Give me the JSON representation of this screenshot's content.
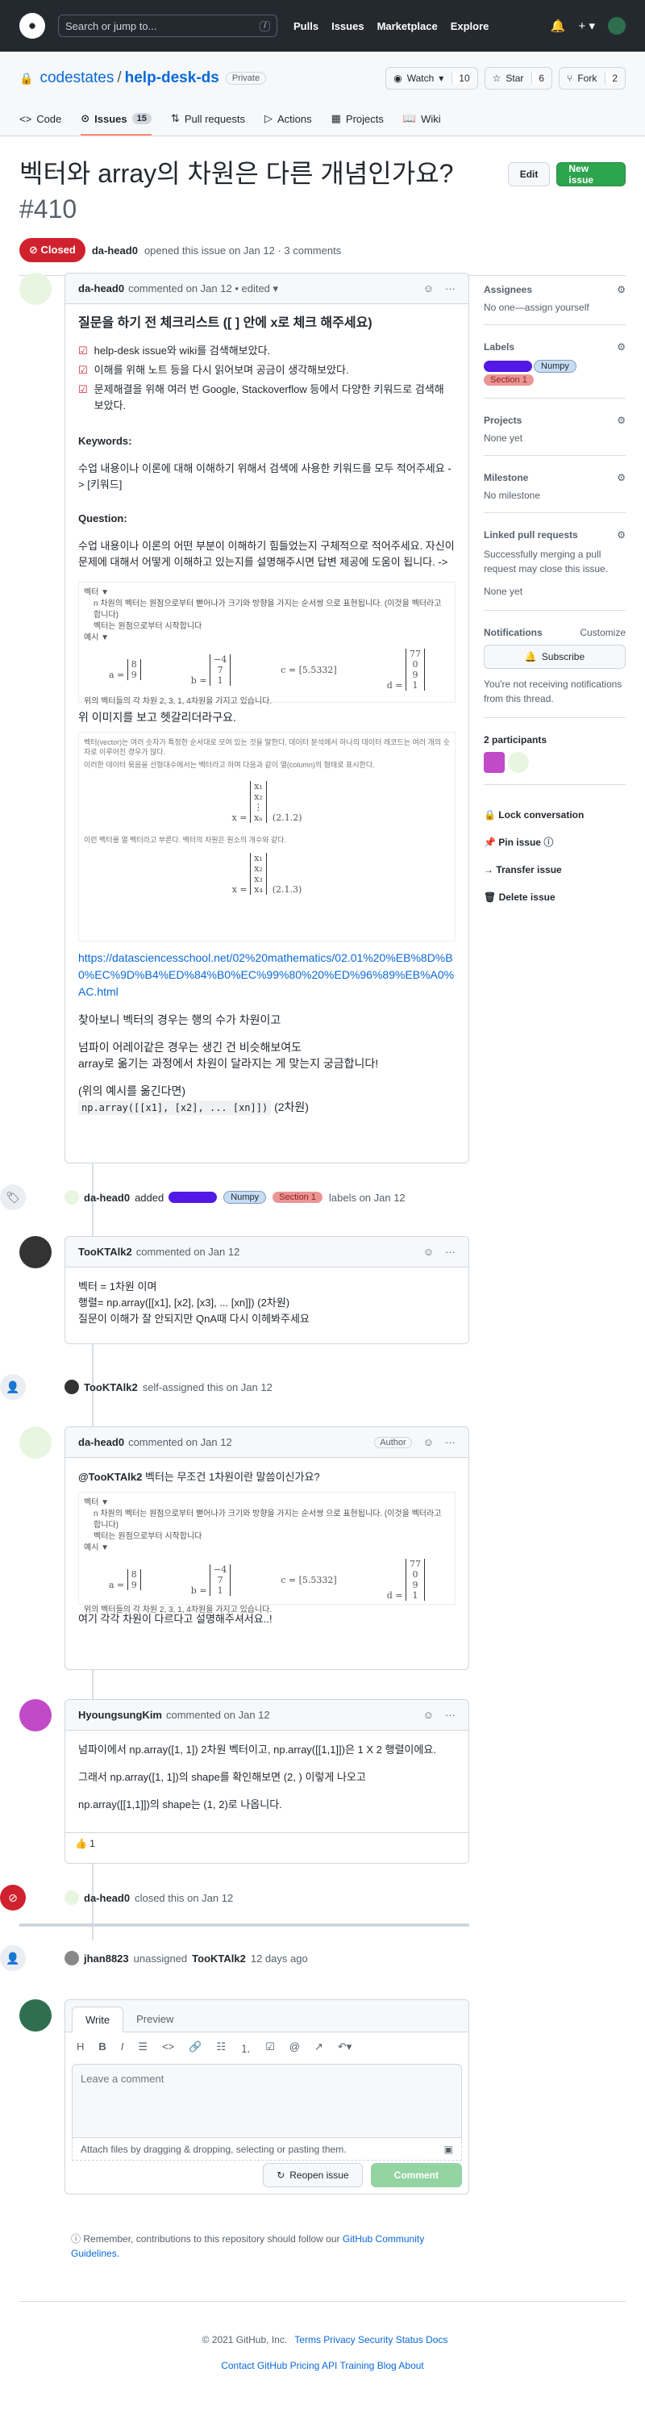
{
  "header": {
    "search": "Search or jump to...",
    "slash": "/",
    "nav": [
      "Pulls",
      "Issues",
      "Marketplace",
      "Explore"
    ]
  },
  "repo": {
    "owner": "codestates",
    "name": "help-desk-ds",
    "visibility": "Private",
    "watch": "Watch",
    "watch_count": "10",
    "star": "Star",
    "star_count": "6",
    "fork": "Fork",
    "fork_count": "2"
  },
  "tabs": [
    {
      "label": "Code"
    },
    {
      "label": "Issues",
      "count": "15"
    },
    {
      "label": "Pull requests"
    },
    {
      "label": "Actions"
    },
    {
      "label": "Projects"
    },
    {
      "label": "Wiki"
    }
  ],
  "issue": {
    "title": "벡터와 array의 차원은 다른 개념인가요?",
    "number": "#410",
    "edit": "Edit",
    "new": "New issue",
    "status": "Closed",
    "meta_author": "da-head0",
    "meta": "opened this issue on Jan 12 · 3 comments"
  },
  "c1": {
    "author": "da-head0",
    "meta": "commented on Jan 12 • edited ▾",
    "h": "질문을 하기 전 체크리스트 ([ ] 안에 x로 체크 해주세요)",
    "checks": [
      "help-desk issue와 wiki를 검색해보았다.",
      "이해를 위해 노트 등을 다시 읽어보며 공금이 생각해보았다.",
      "문제해결을 위해 여러 번 Google, Stackoverflow 등에서 다양한 키워드로 검색해 보았다."
    ],
    "kw_h": "Keywords:",
    "kw": "수업 내용이나 이론에 대해 이해하기 위해서 검색에 사용한 키워드를 모두 적어주세요 -> [키워드]",
    "q_h": "Question:",
    "q": "수업 내용이나 이론의 어떤 부분이 이해하기 힘들었는지 구체적으로 적어주세요. 자신이 문제에 대해서 어떻게 이해하고 있는지를 설명해주시면 답변 제공에 도움이 됩니다. ->",
    "img_lines": [
      "벡터 ▼",
      "n 차원의 벡터는 원점으로부터 뻗어나가 크기와 방향을 가지는 순서쌍 으로 표현됩니다. (이것을 벡터라고 합니다)",
      "벡터는 원점으로부터 시작합니다",
      "예시 ▼"
    ],
    "img_caption": "위의 벡터들의 각 차원 2, 3, 1, 4차원을 가지고 있습니다.",
    "p1": "위 이미지를 보고 헷갈리더라구요.",
    "link": "https://datasciencesschool.net/02%20mathematics/02.01%20%EB%8D%B0%EC%9D%B4%ED%84%B0%EC%99%80%20%ED%96%89%EB%A0%AC.html",
    "p2": "찾아보니 벡터의 경우는 행의 수가 차원이고",
    "p3a": "넘파이 어레이같은 경우는 생긴 건 비슷해보여도",
    "p3b": "array로 옮기는 과정에서 차원이 달라지는 게 맞는지 궁금합니다!",
    "p4a": "(위의 예시를 옮긴다면)",
    "code": "np.array([[x1], [x2], ... [xn]])",
    "p4b": "(2차원)"
  },
  "labels_event": {
    "author": "da-head0",
    "added": "added",
    "labels": [
      "Question",
      "Numpy",
      "Section 1"
    ],
    "tail": "labels on Jan 12"
  },
  "c2": {
    "author": "TooKTAlk2",
    "meta": "commented on Jan 12",
    "lines": [
      "벡터 = 1차원 이며",
      "행렬= np.array([[x1], [x2], [x3], ... [xn]]) (2차원)",
      "질문이 이해가 잘 안되지만 QnA때 다시 이헤봐주세요"
    ]
  },
  "assign_event": {
    "author": "TooKTAlk2",
    "text": "self-assigned this on Jan 12"
  },
  "c3": {
    "author": "da-head0",
    "meta": "commented on Jan 12",
    "role": "Author",
    "mention": "@TooKTAlk2",
    "text": "벡터는 무조건 1차원이란 말씀이신가요?",
    "last": "여기 각각 차원이 다르다고 설명해주셔서요..!"
  },
  "c4": {
    "author": "HyoungsungKim",
    "meta": "commented on Jan 12",
    "lines": [
      "넘파이에서 np.array([1, 1]) 2차원 벡터이고, np.array([[1,1]])은 1 X 2 행렬이에요.",
      "그래서 np.array([1, 1])의 shape를 확인해보면 (2, ) 이렇게 나오고",
      "np.array([[1,1]])의 shape는 (1, 2)로 나옵니다."
    ],
    "reaction": "👍 1"
  },
  "close_event": {
    "author": "da-head0",
    "text": "closed this on Jan 12"
  },
  "unassign_event": {
    "author": "jhan8823",
    "text": "unassigned",
    "target": "TooKTAlk2",
    "time": "12 days ago"
  },
  "editor": {
    "write": "Write",
    "preview": "Preview",
    "placeholder": "Leave a comment",
    "attach": "Attach files by dragging & dropping, selecting or pasting them.",
    "reopen": "Reopen issue",
    "comment": "Comment"
  },
  "remember": "Remember, contributions to this repository should follow our",
  "guidelines": "GitHub Community Guidelines.",
  "sidebar": {
    "assignees_h": "Assignees",
    "assignees": "No one—assign yourself",
    "labels_h": "Labels",
    "labels": [
      "Question",
      "Numpy",
      "Section 1"
    ],
    "projects_h": "Projects",
    "projects": "None yet",
    "milestone_h": "Milestone",
    "milestone": "No milestone",
    "linked_h": "Linked pull requests",
    "linked": "Successfully merging a pull request may close this issue.",
    "linked_none": "None yet",
    "notif_h": "Notifications",
    "customize": "Customize",
    "subscribe": "Subscribe",
    "notif_text": "You're not receiving notifications from this thread.",
    "participants": "2 participants",
    "lock": "Lock conversation",
    "pin": "Pin issue",
    "transfer": "Transfer issue",
    "delete": "Delete issue"
  },
  "footer": {
    "copyright": "© 2021 GitHub, Inc.",
    "row1": [
      "Terms",
      "Privacy",
      "Security",
      "Status",
      "Docs"
    ],
    "row2": [
      "Contact GitHub",
      "Pricing",
      "API",
      "Training",
      "Blog",
      "About"
    ]
  },
  "colors": {
    "closed": "#cf222e",
    "green": "#2da44e",
    "question": "#5319e7",
    "numpy": "#c5def5",
    "section1": "#e99695"
  }
}
